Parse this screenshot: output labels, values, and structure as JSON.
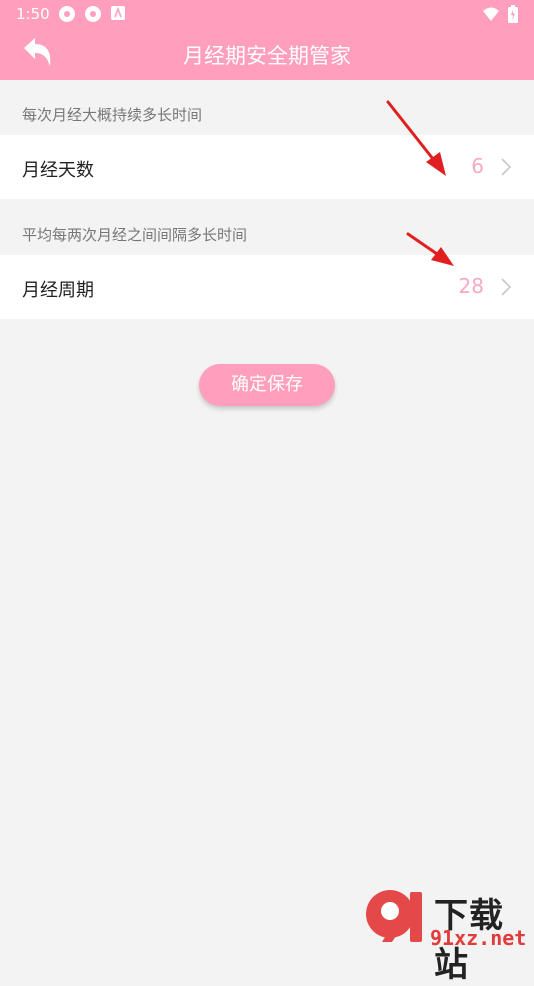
{
  "status_bar": {
    "time": "1:50"
  },
  "header": {
    "title": "月经期安全期管家"
  },
  "period_length": {
    "hint": "每次月经大概持续多长时间",
    "label": "月经天数",
    "value": "6"
  },
  "cycle_length": {
    "hint": "平均每两次月经之间间隔多长时间",
    "label": "月经周期",
    "value": "28"
  },
  "save_button": {
    "label": "确定保存"
  },
  "watermark": {
    "brand": "下载站",
    "site": "91xz.net"
  },
  "colors": {
    "accent": "#ff9fbd",
    "value_text": "#f8a9c3",
    "annotation_arrow": "#e02020"
  }
}
